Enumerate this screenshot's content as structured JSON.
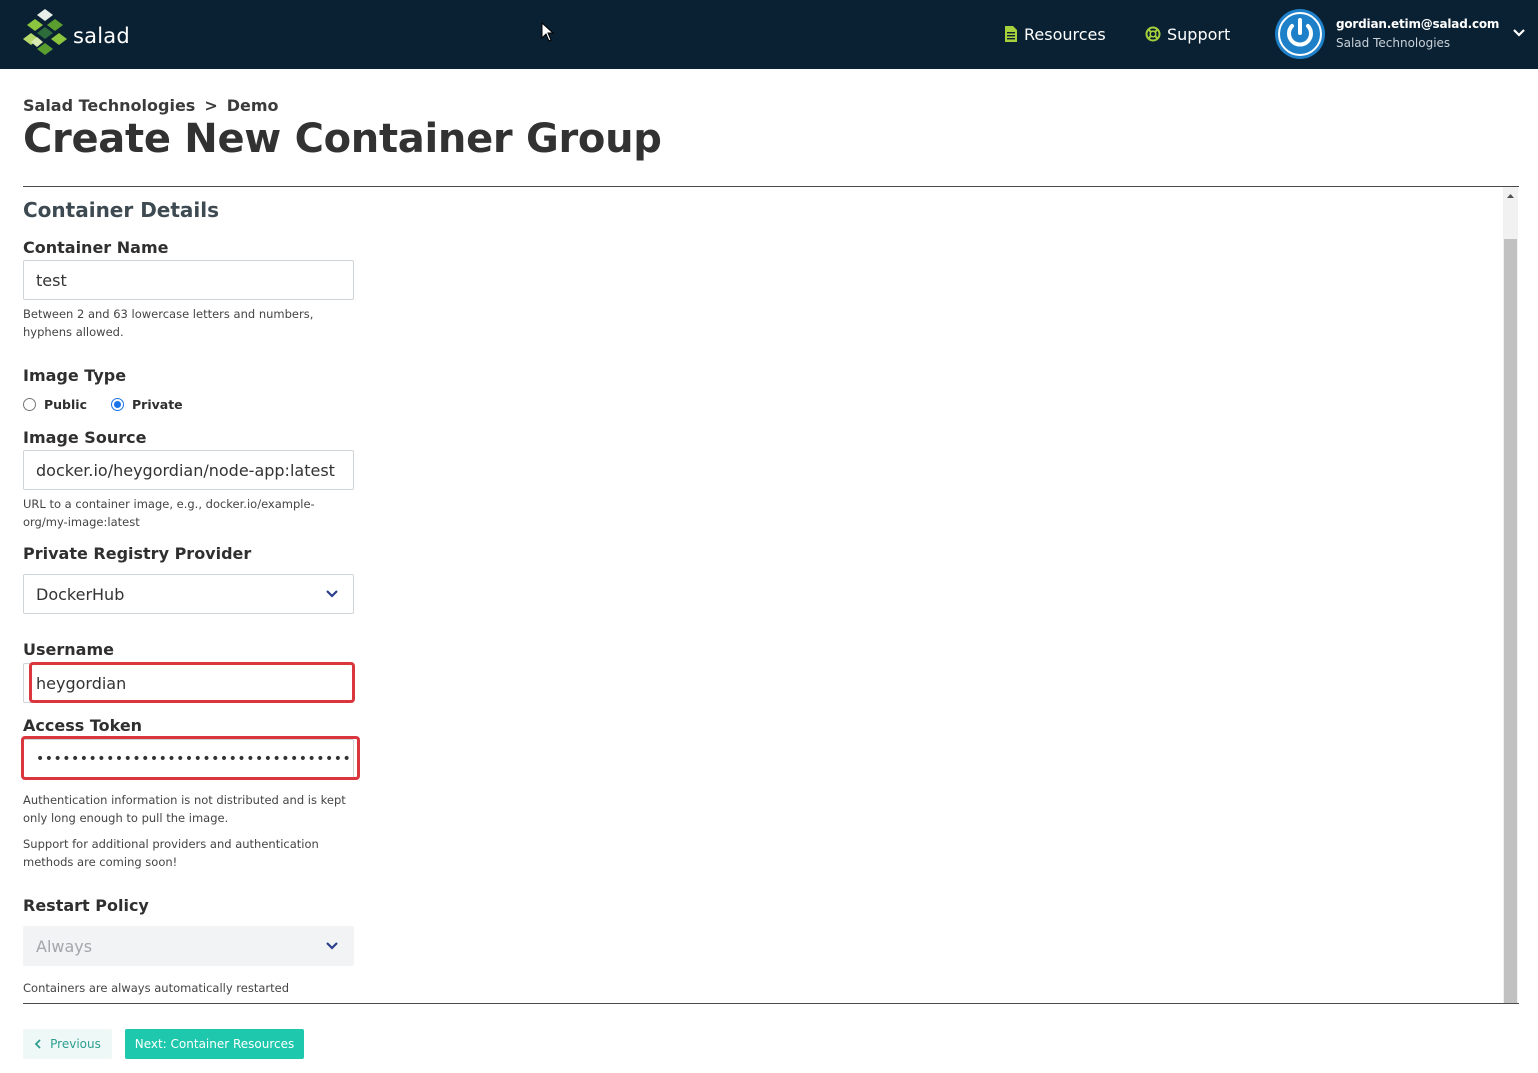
{
  "nav": {
    "logo_text": "salad",
    "resources_label": "Resources",
    "support_label": "Support",
    "user_email": "gordian.etim@salad.com",
    "user_org": "Salad Technologies"
  },
  "breadcrumb": {
    "org": "Salad Technologies",
    "separator": ">",
    "project": "Demo"
  },
  "page_title": "Create New Container Group",
  "form": {
    "section_title": "Container Details",
    "container_name": {
      "label": "Container Name",
      "value": "test",
      "hint": "Between 2 and 63 lowercase letters and numbers, hyphens allowed."
    },
    "image_type": {
      "label": "Image Type",
      "options": [
        "Public",
        "Private"
      ],
      "selected": "Private"
    },
    "image_source": {
      "label": "Image Source",
      "value": "docker.io/heygordian/node-app:latest",
      "hint": "URL to a container image, e.g., docker.io/example-org/my-image:latest"
    },
    "registry_provider": {
      "label": "Private Registry Provider",
      "value": "DockerHub"
    },
    "username": {
      "label": "Username",
      "value": "heygordian"
    },
    "access_token": {
      "label": "Access Token",
      "value": "••••••••••••••••••••••••••••••••••••",
      "hint1": "Authentication information is not distributed and is kept only long enough to pull the image.",
      "hint2": "Support for additional providers and authentication methods are coming soon!"
    },
    "restart_policy": {
      "label": "Restart Policy",
      "value": "Always",
      "hint": "Containers are always automatically restarted"
    }
  },
  "buttons": {
    "previous_label": "Previous",
    "next_label": "Next: Container Resources"
  },
  "colors": {
    "topbar": "#0a2133",
    "accent": "#1ec8ac",
    "highlight": "#d9363e",
    "logo_green": "#8cc63f"
  }
}
